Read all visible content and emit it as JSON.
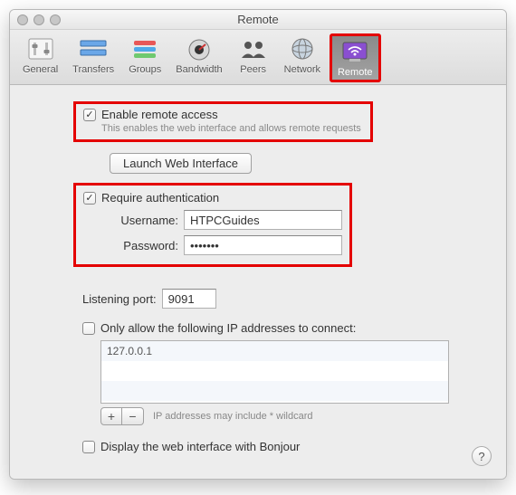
{
  "window": {
    "title": "Remote"
  },
  "toolbar": {
    "items": [
      {
        "label": "General"
      },
      {
        "label": "Transfers"
      },
      {
        "label": "Groups"
      },
      {
        "label": "Bandwidth"
      },
      {
        "label": "Peers"
      },
      {
        "label": "Network"
      },
      {
        "label": "Remote"
      }
    ]
  },
  "remote": {
    "enable_label": "Enable remote access",
    "enable_sub": "This enables the web interface and allows remote requests",
    "launch_btn": "Launch Web Interface",
    "auth_label": "Require authentication",
    "username_label": "Username:",
    "username_value": "HTPCGuides",
    "password_label": "Password:",
    "password_value": "•••••••",
    "port_label": "Listening port:",
    "port_value": "9091",
    "ip_restrict_label": "Only allow the following IP addresses to connect:",
    "ip_list_value": "127.0.0.1",
    "ip_note": "IP addresses may include * wildcard",
    "bonjour_label": "Display the web interface with Bonjour",
    "plus": "+",
    "minus": "−",
    "help": "?"
  }
}
